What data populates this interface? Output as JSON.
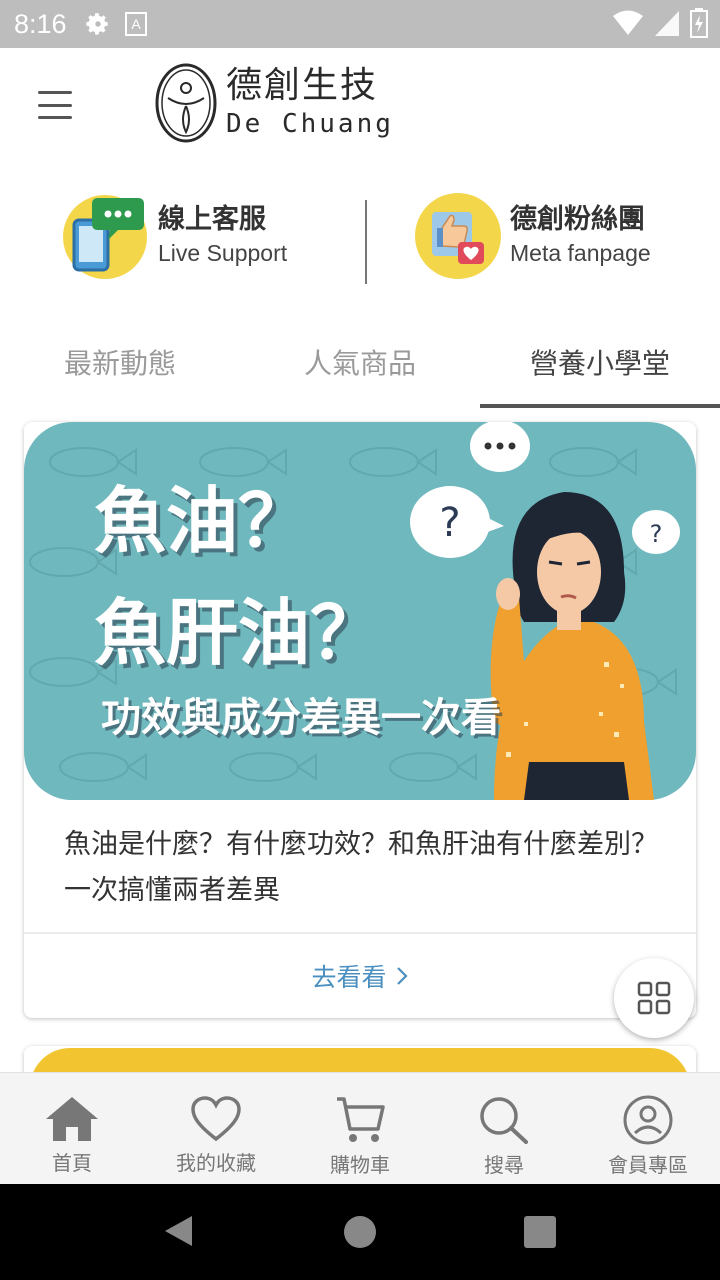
{
  "status_bar": {
    "time": "8:16",
    "icons": [
      "settings-icon",
      "a-notification-icon",
      "wifi-icon",
      "signal-icon",
      "battery-icon"
    ]
  },
  "header": {
    "logo_cn": "德創生技",
    "logo_en": "De Chuang",
    "menu_icon": "hamburger-menu-icon"
  },
  "quick_links": [
    {
      "title": "線上客服",
      "subtitle": "Live Support",
      "icon": "chat-phone-icon"
    },
    {
      "title": "德創粉絲團",
      "subtitle": "Meta fanpage",
      "icon": "thumbs-up-heart-icon"
    }
  ],
  "tabs": [
    {
      "label": "最新動態",
      "active": false
    },
    {
      "label": "人氣商品",
      "active": false
    },
    {
      "label": "營養小學堂",
      "active": true
    }
  ],
  "article": {
    "banner": {
      "line1": "魚油？",
      "line2": "魚肝油？",
      "line3": "功效與成分差異一次看"
    },
    "title": "魚油是什麼？有什麼功效？和魚肝油有什麼差別？ 一次搞懂兩者差異",
    "link_label": "去看看"
  },
  "bottom_nav": [
    {
      "label": "首頁",
      "icon": "home-icon",
      "active": true
    },
    {
      "label": "我的收藏",
      "icon": "heart-icon",
      "active": false
    },
    {
      "label": "購物車",
      "icon": "cart-icon",
      "active": false
    },
    {
      "label": "搜尋",
      "icon": "search-icon",
      "active": false
    },
    {
      "label": "會員專區",
      "icon": "user-icon",
      "active": false
    }
  ],
  "colors": {
    "banner_bg": "#6fb8bd",
    "accent_blue": "#4a8fc0",
    "status_bar": "#bdbdbd",
    "quick_icon_bg": "#f3d64a",
    "next_card": "#f2c530"
  }
}
